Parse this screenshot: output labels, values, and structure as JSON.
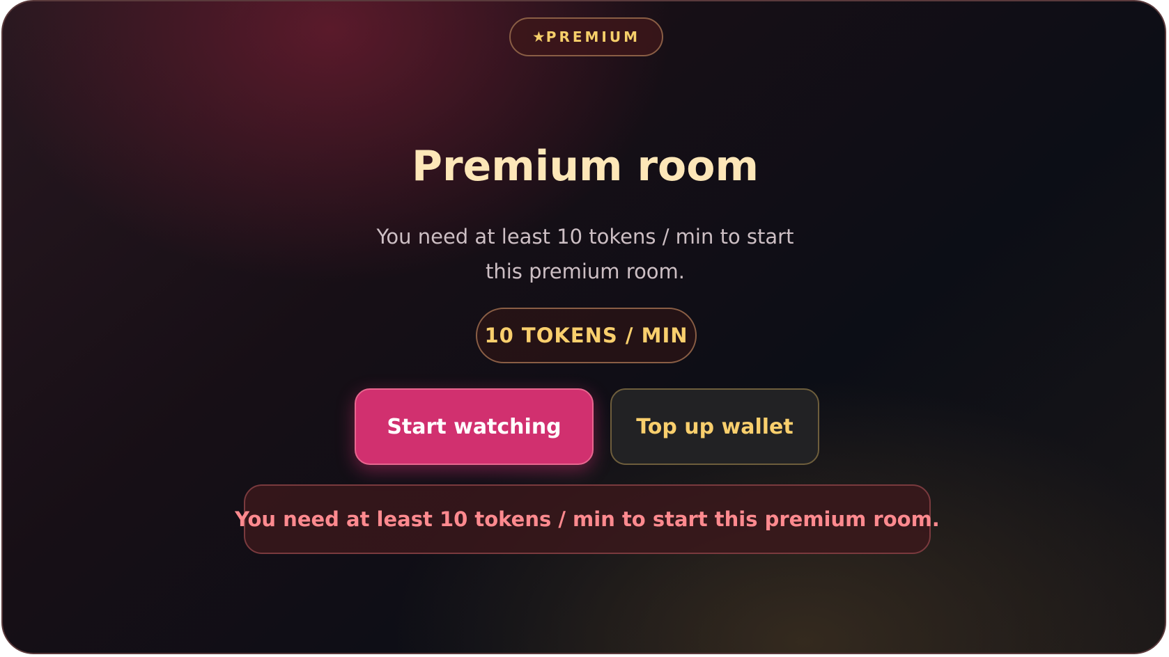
{
  "badge": {
    "star": "★",
    "label": "PREMIUM"
  },
  "room": {
    "title": "Premium room",
    "description": "You need at least 10 tokens / min to start this premium room.",
    "rate": "10 TOKENS / MIN"
  },
  "actions": {
    "start_label": "Start watching",
    "topup_label": "Top up wallet"
  },
  "error": {
    "message": "You need at least 10 tokens / min to start this premium room."
  },
  "colors": {
    "accent": "#d1306f",
    "gold": "#f9cf6d",
    "error": "#ff8a8f",
    "title": "#fde7b8"
  },
  "icons": {
    "badge_icon": "star-icon"
  }
}
